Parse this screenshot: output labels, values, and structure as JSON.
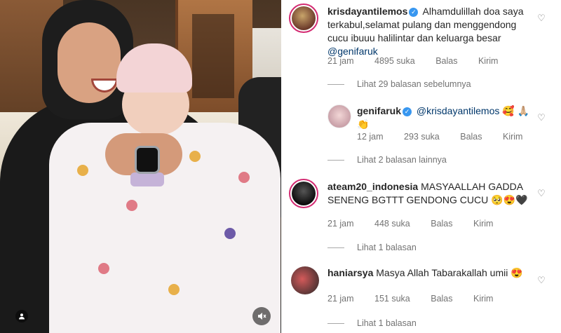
{
  "post": {
    "photo_alt": "",
    "mute_icon": "speaker-muted-icon",
    "tag_icon": "user-tag-icon"
  },
  "comments": [
    {
      "username": "krisdayantilemos",
      "verified": true,
      "text": "Alhamdulillah doa saya terkabul,selamat pulang dan menggendong cucu ibuuu halilintar dan keluarga besar",
      "mention": "@genifaruk",
      "time": "21 jam",
      "likes": "4895 suka",
      "reply": "Balas",
      "send": "Kirim",
      "view_replies": "Lihat 29 balasan sebelumnya"
    },
    {
      "username": "genifaruk",
      "verified": true,
      "mention": "@krisdayantilemos",
      "text": "🥰 🙏🏼👏",
      "time": "12 jam",
      "likes": "293 suka",
      "reply": "Balas",
      "send": "Kirim",
      "view_replies": "Lihat 2 balasan lainnya"
    },
    {
      "username": "ateam20_indonesia",
      "verified": false,
      "text": "MASYAALLAH GADDA SENENG BGTTT GENDONG CUCU 🥺😍🖤",
      "time": "21 jam",
      "likes": "448 suka",
      "reply": "Balas",
      "send": "Kirim",
      "view_replies": "Lihat 1 balasan"
    },
    {
      "username": "haniarsya",
      "verified": false,
      "text": "Masya Allah Tabarakallah umii 😍",
      "time": "21 jam",
      "likes": "151 suka",
      "reply": "Balas",
      "send": "Kirim",
      "view_replies": "Lihat 1 balasan"
    }
  ],
  "colors": {
    "text": "#262626",
    "muted": "#737373",
    "mention": "#00376b",
    "story_ring": "#d32b72",
    "verified": "#3897f0"
  },
  "icons": {
    "heart": "heart-outline-icon",
    "verified": "verified-badge-icon"
  }
}
